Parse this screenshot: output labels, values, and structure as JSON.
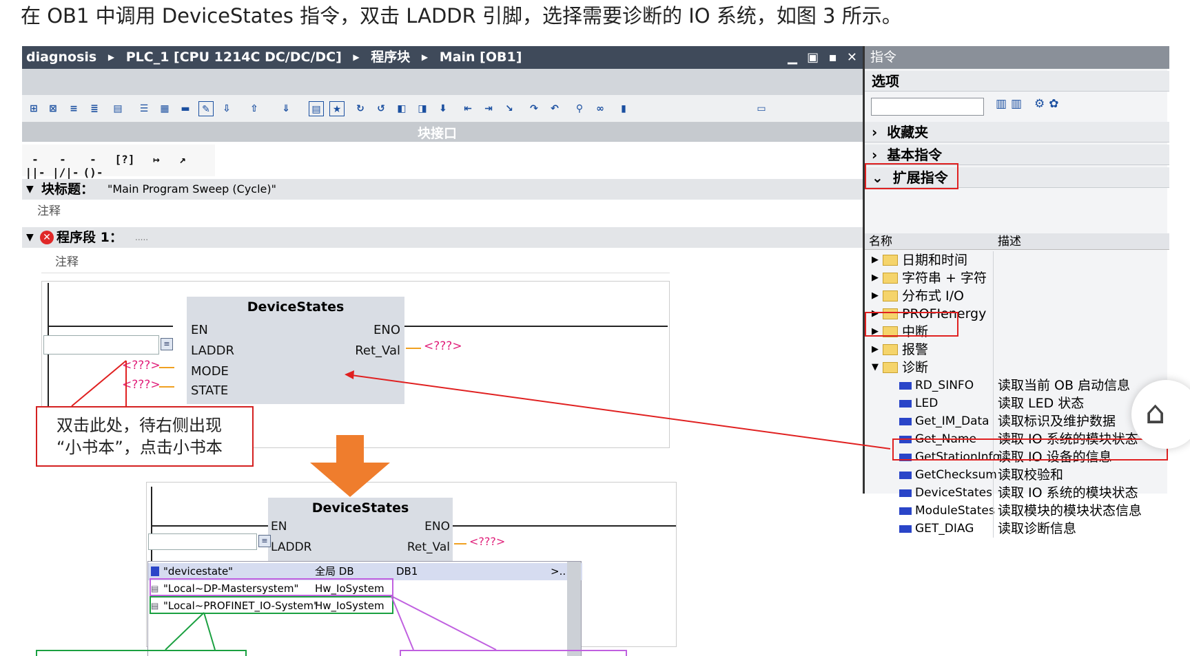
{
  "caption": "在 OB1 中调用 DeviceStates 指令，双击 LADDR 引脚，选择需要诊断的 IO 系统，如图 3 所示。",
  "breadcrumb": [
    "diagnosis",
    "PLC_1 [CPU 1214C DC/DC/DC]",
    "程序块",
    "Main [OB1]"
  ],
  "window_controls": "▁ ▣ ▪ ✕",
  "block_interface_label": "块接口",
  "block_title_label": "块标题：",
  "block_title_value": "\"Main Program Sweep (Cycle)\"",
  "comment_label": "注释",
  "network_label": "程序段 1：",
  "network_dots": ".....",
  "fb": {
    "name": "DeviceStates",
    "en": "EN",
    "eno": "ENO",
    "laddr": "LADDR",
    "ret_val": "Ret_Val",
    "mode": "MODE",
    "state": "STATE",
    "unknown": "<???>"
  },
  "annotation_text_1": "双击此处，待右侧出现",
  "annotation_text_2": "“小书本”，点击小书本",
  "dropdown": {
    "rows": [
      {
        "name": "\"devicestate\"",
        "type": "全局 DB",
        "num": "DB1"
      },
      {
        "name": "\"Local~DP-Mastersystem\"",
        "type": "Hw_IoSystem",
        "num": ""
      },
      {
        "name": "\"Local~PROFINET_IO-System\"",
        "type": "Hw_IoSystem",
        "num": ""
      }
    ],
    "more": ">.."
  },
  "right_panel": {
    "title": "指令",
    "options": "选项",
    "favorites": "收藏夹",
    "basic": "基本指令",
    "extended": "扩展指令",
    "col_name": "名称",
    "col_desc": "描述",
    "folders": [
      "日期和时间",
      "字符串 + 字符",
      "分布式 I/O",
      "PROFIenergy",
      "中断",
      "报警",
      "诊断"
    ],
    "items": [
      {
        "name": "RD_SINFO",
        "desc": "读取当前 OB 启动信息"
      },
      {
        "name": "LED",
        "desc": "读取 LED 状态"
      },
      {
        "name": "Get_IM_Data",
        "desc": "读取标识及维护数据"
      },
      {
        "name": "Get_Name",
        "desc": "读取 IO 系统的模块状态"
      },
      {
        "name": "GetStationInfo",
        "desc": "读取 IO 设备的信息"
      },
      {
        "name": "GetChecksum",
        "desc": "读取校验和"
      },
      {
        "name": "DeviceStates",
        "desc": "读取 IO 系统的模块状态"
      },
      {
        "name": "ModuleStates",
        "desc": "读取模块的模块状态信息"
      },
      {
        "name": "GET_DIAG",
        "desc": "读取诊断信息"
      }
    ]
  },
  "colors": {
    "titlebar": "#3f4a5a",
    "annotation_red": "#e02020",
    "arrow_orange": "#ef7d2d",
    "box_green": "#1aa040",
    "box_purple": "#c060e0",
    "unknown_pink": "#e0207a"
  }
}
